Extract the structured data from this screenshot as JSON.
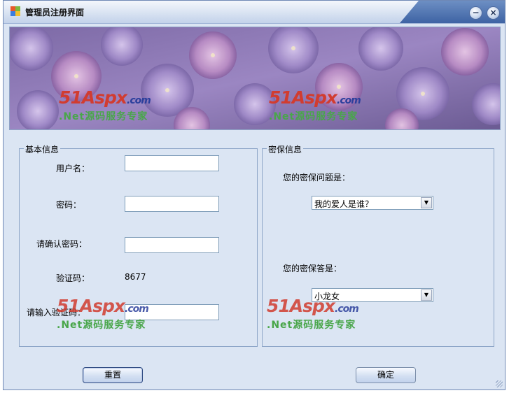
{
  "window": {
    "title": "管理员注册界面",
    "minimize": "−",
    "close": "×"
  },
  "watermark": {
    "logo": "51Aspx",
    "domain": ".com",
    "slogan": ".Net源码服务专家"
  },
  "basic": {
    "legend": "基本信息",
    "username_label": "用户名：",
    "password_label": "密码：",
    "confirm_label": "请确认密码：",
    "captcha_label": "验证码：",
    "captcha_value": "8677",
    "captcha_input_label": "请输入验证码："
  },
  "security": {
    "legend": "密保信息",
    "question_label": "您的密保问题是：",
    "question_value": "我的爱人是谁？",
    "answer_label": "您的密保答是：",
    "answer_value": "小龙女"
  },
  "buttons": {
    "reset": "重置",
    "ok": "确定"
  }
}
